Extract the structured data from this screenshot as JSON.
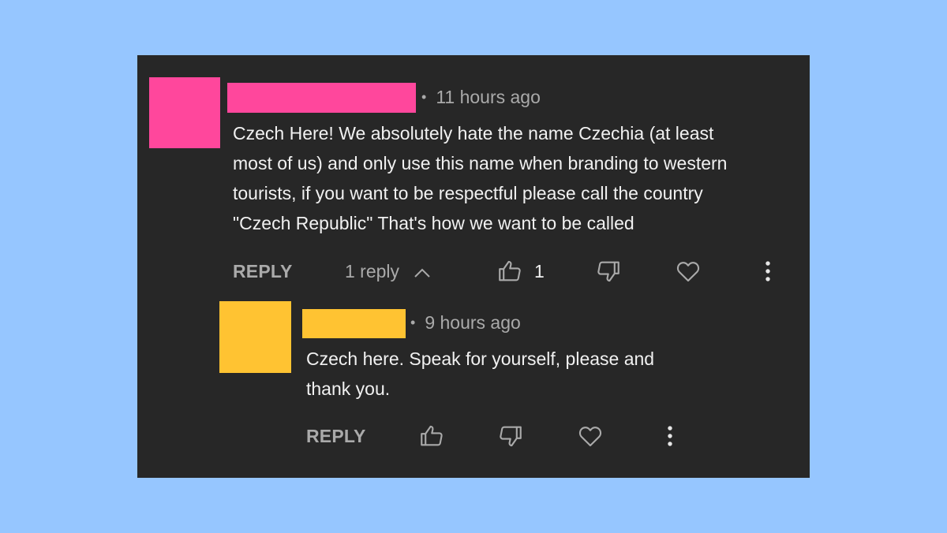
{
  "colors": {
    "page_background": "#96c6ff",
    "card_background": "#272727",
    "primary_avatar": "#ff479c",
    "reply_avatar": "#ffc332",
    "muted_text": "#aaaaaa",
    "body_text": "#f1f1f1"
  },
  "comment": {
    "timestamp": "11 hours ago",
    "text": "Czech Here! We absolutely hate the name Czechia (at least\nmost of us) and only use this name when branding to western\ntourists, if you want to be respectful please call the country\n\"Czech Republic\" That's how we want to be called",
    "reply_label": "REPLY",
    "replies_toggle_label": "1 reply",
    "like_count": "1",
    "icons": [
      "thumb-up-icon",
      "thumb-down-icon",
      "heart-icon",
      "more-vertical-icon",
      "chevron-up-icon"
    ]
  },
  "reply": {
    "timestamp": "9 hours ago",
    "text": "Czech here. Speak for yourself, please and\nthank you.",
    "reply_label": "REPLY",
    "icons": [
      "thumb-up-icon",
      "thumb-down-icon",
      "heart-icon",
      "more-vertical-icon"
    ]
  }
}
